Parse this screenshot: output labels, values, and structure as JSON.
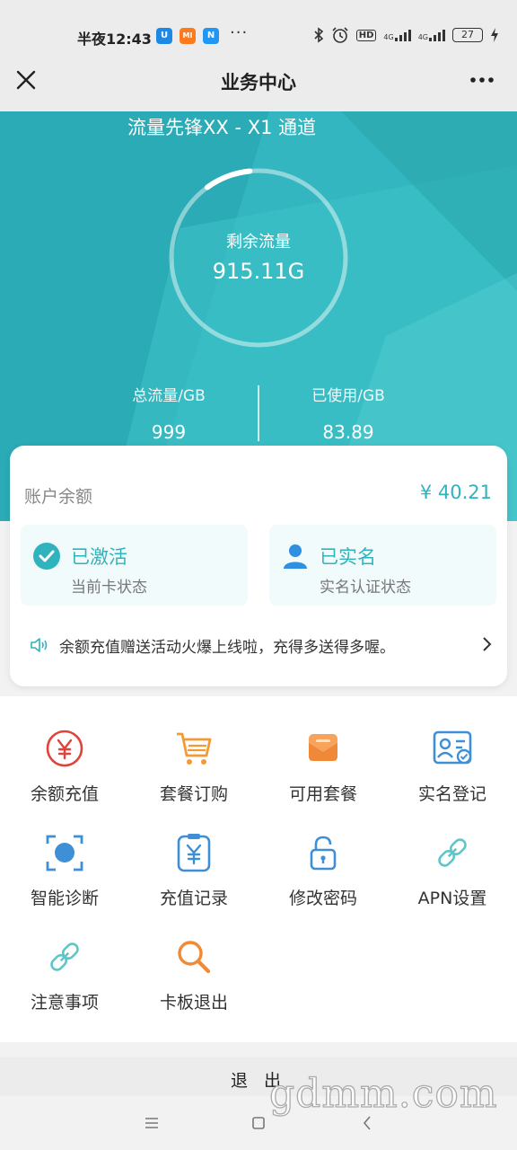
{
  "status_bar": {
    "time": "半夜12:43",
    "apps": [
      {
        "icon": "app-u-icon",
        "glyph": "U",
        "color": "#1e88e5"
      },
      {
        "icon": "app-mi-icon",
        "glyph": "MI",
        "color": "#ff7a1a"
      },
      {
        "icon": "app-n-icon",
        "glyph": "N",
        "color": "#2196f3"
      }
    ],
    "more": "···",
    "hd_label": "HD",
    "net_label_1": "4G",
    "net_label_2": "4G",
    "battery_level": "27"
  },
  "header": {
    "title": "业务中心"
  },
  "flow": {
    "card_title": "流量先锋XX - X1 通道",
    "remaining_label": "剩余流量",
    "remaining_value": "915.11G",
    "used_fraction": 0.084,
    "total_label": "总流量/GB",
    "total_value": "999",
    "used_label": "已使用/GB",
    "used_value": "83.89"
  },
  "account": {
    "balance_label": "账户余额",
    "balance_value": "¥ 40.21",
    "status_cards": [
      {
        "title": "已激活",
        "subtitle": "当前卡状态",
        "icon": "check-circle-icon"
      },
      {
        "title": "已实名",
        "subtitle": "实名认证状态",
        "icon": "user-icon"
      }
    ],
    "notice": "余额充值赠送活动火爆上线啦，充得多送得多喔。"
  },
  "menu": [
    {
      "label": "余额充值",
      "icon": "yen-circle-icon"
    },
    {
      "label": "套餐订购",
      "icon": "cart-icon"
    },
    {
      "label": "可用套餐",
      "icon": "envelope-icon"
    },
    {
      "label": "实名登记",
      "icon": "id-card-icon"
    },
    {
      "label": "智能诊断",
      "icon": "scan-icon"
    },
    {
      "label": "充值记录",
      "icon": "clipboard-yen-icon"
    },
    {
      "label": "修改密码",
      "icon": "lock-icon"
    },
    {
      "label": "APN设置",
      "icon": "link-icon"
    },
    {
      "label": "注意事项",
      "icon": "link-icon"
    },
    {
      "label": "卡板退出",
      "icon": "search-icon"
    }
  ],
  "footer": {
    "logout_label": "退 出"
  },
  "watermark": "gdmm.com",
  "colors": {
    "accent": "#2fb3bc",
    "orange": "#f39a34",
    "blue": "#3f8fd6",
    "red": "#e0433a"
  }
}
